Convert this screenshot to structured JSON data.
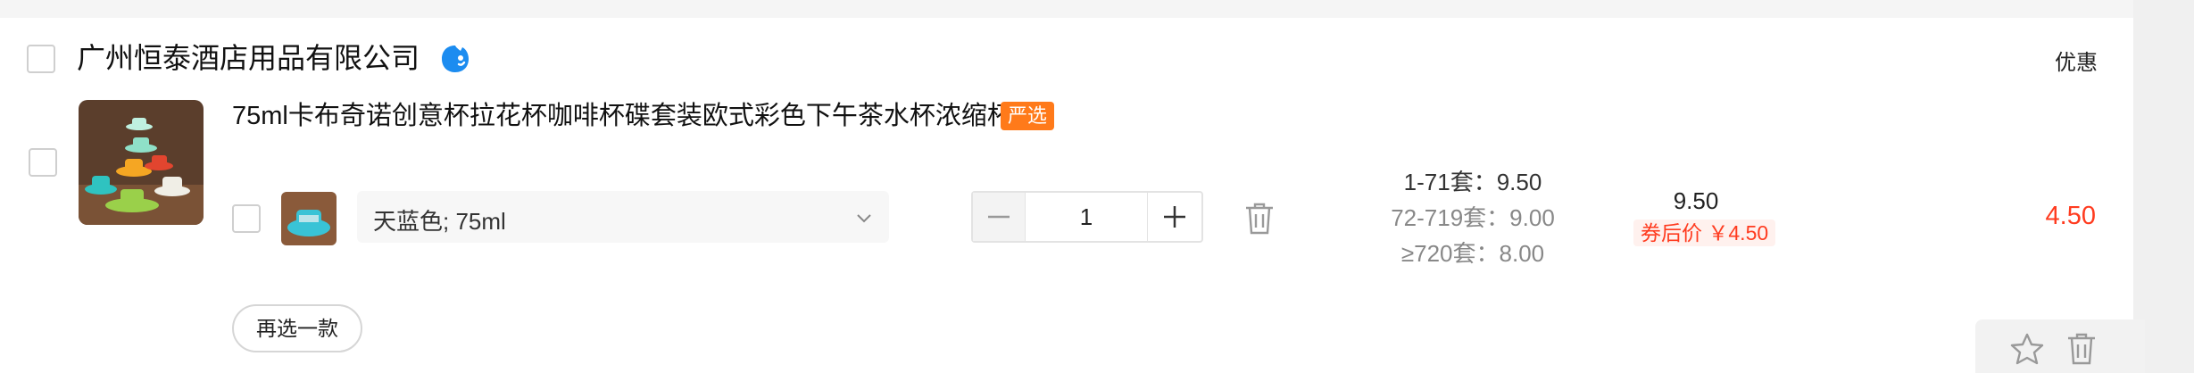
{
  "shop": {
    "name": "广州恒泰酒店用品有限公司",
    "promo_label": "优惠"
  },
  "item": {
    "title": "75ml卡布奇诺创意杯拉花杯咖啡杯碟套装欧式彩色下午茶水杯浓缩杯",
    "badge": "严选",
    "sku": "天蓝色; 75ml",
    "quantity": "1",
    "tiers": [
      "1-71套：9.50",
      "72-719套：9.00",
      "≥720套：8.00"
    ],
    "unit_price": "9.50",
    "coupon_price": "券后价 ￥4.50",
    "subtotal": "4.50",
    "reselect_label": "再选一款"
  },
  "colors": {
    "accent": "#ff3b1f",
    "badge": "#ff7a1a",
    "brand_icon": "#1c8cf0"
  },
  "icons": [
    "wangwang-chat-icon",
    "chevron-down-icon",
    "minus-icon",
    "plus-icon",
    "trash-icon",
    "star-icon"
  ]
}
